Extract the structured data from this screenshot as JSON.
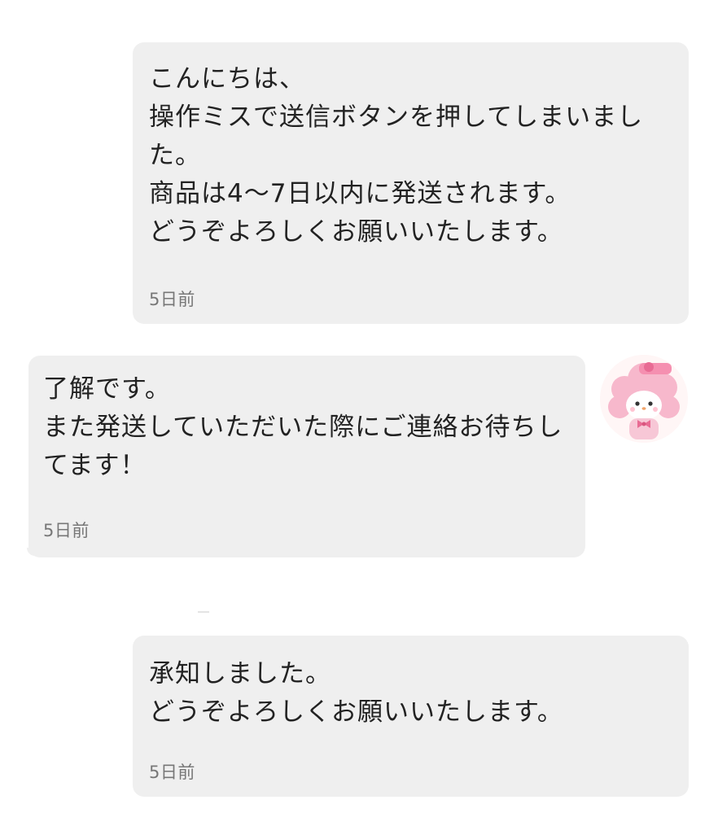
{
  "messages": [
    {
      "side": "right",
      "text": "こんにちは、\n操作ミスで送信ボタンを押してしまいました。\n商品は4〜7日以内に発送されます。\nどうぞよろしくお願いいたします。",
      "time": "5日前"
    },
    {
      "side": "left",
      "text": "了解です。\nまた発送していただいた際にご連絡お待ちしてます！",
      "time": "5日前",
      "avatar": "pink-rabbit-character-avatar"
    },
    {
      "side": "right",
      "text": "承知しました。\nどうぞよろしくお願いいたします。",
      "time": "5日前"
    }
  ],
  "colors": {
    "bubble": "#efefef",
    "text": "#222222",
    "timestamp": "#777777",
    "avatar_pink": "#f7b8cc"
  }
}
